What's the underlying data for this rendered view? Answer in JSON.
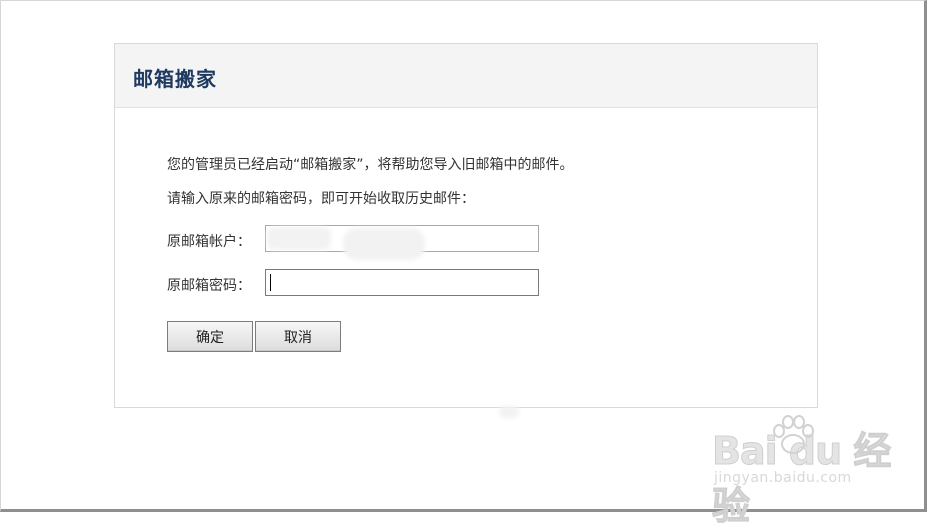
{
  "panel": {
    "title": "邮箱搬家"
  },
  "info": {
    "line1": "您的管理员已经启动“邮箱搬家”，将帮助您导入旧邮箱中的邮件。",
    "line2": "请输入原来的邮箱密码，即可开始收取历史邮件："
  },
  "form": {
    "account_label": "原邮箱帐户：",
    "account_value": "@a      o",
    "password_label": "原邮箱密码：",
    "password_value": ""
  },
  "buttons": {
    "ok_label": "确定",
    "cancel_label": "取消"
  },
  "watermark": {
    "logo_text": "Bai du 经验",
    "url": "jingyan.baidu.com"
  },
  "colors": {
    "title": "#1f3a60",
    "header_bg": "#f4f4f4",
    "text": "#333333",
    "border": "#d9d9d9"
  }
}
